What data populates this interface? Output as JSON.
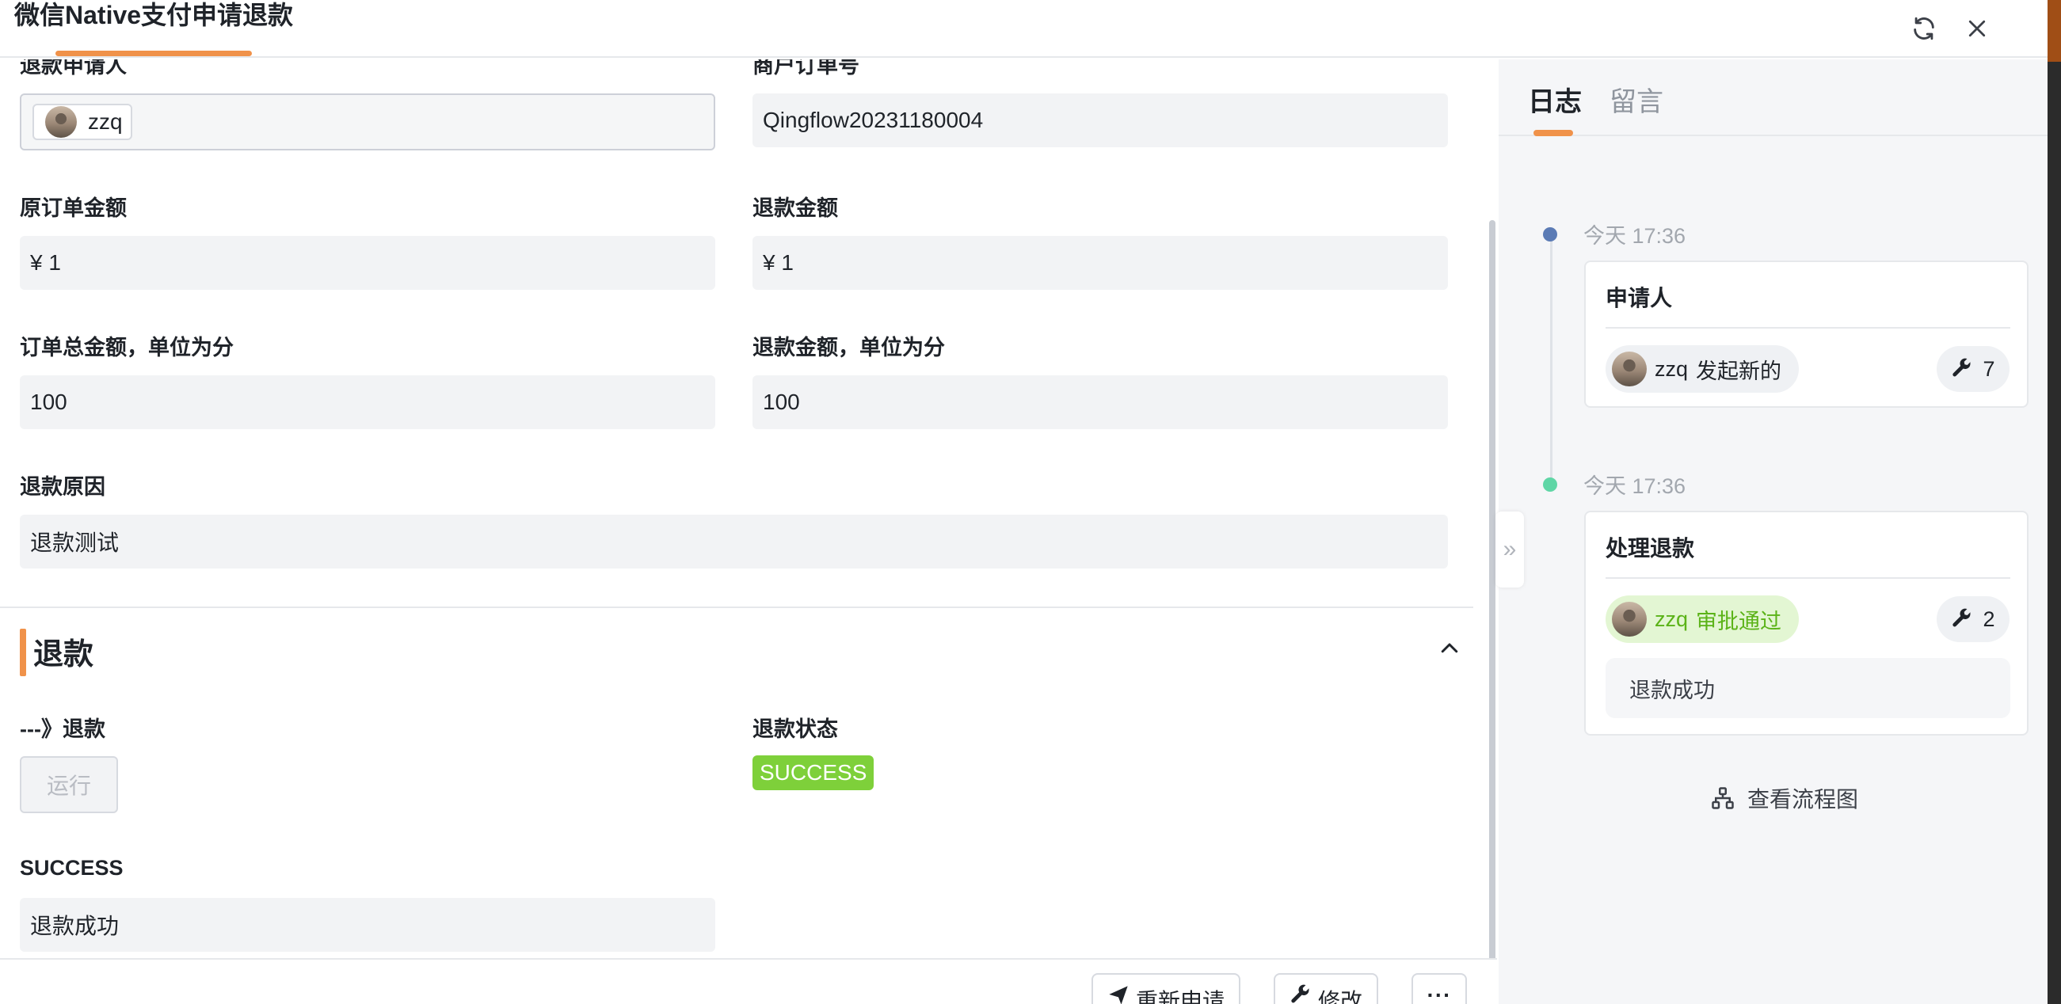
{
  "header": {
    "title": "微信Native支付申请退款",
    "refresh_icon": "refresh-icon",
    "close_icon": "close-icon"
  },
  "form": {
    "applicant_label": "退款申请人",
    "applicant_name": "zzq",
    "merchant_order_label": "商户订单号",
    "merchant_order_value": "Qingflow20231180004",
    "original_amount_label": "原订单金额",
    "original_amount_value": "¥ 1",
    "refund_amount_label": "退款金额",
    "refund_amount_value": "¥ 1",
    "total_cents_label": "订单总金额，单位为分",
    "total_cents_value": "100",
    "refund_cents_label": "退款金额，单位为分",
    "refund_cents_value": "100",
    "reason_label": "退款原因",
    "reason_value": "退款测试"
  },
  "refund_section": {
    "title": "退款",
    "action_label": "---》退款",
    "run_button": "运行",
    "status_label": "退款状态",
    "status_value": "SUCCESS",
    "success_label": "SUCCESS",
    "success_value": "退款成功"
  },
  "footer": {
    "reapply_label": "重新申请",
    "edit_label": "修改",
    "more_label": "···"
  },
  "side": {
    "tabs": [
      {
        "label": "日志",
        "active": true
      },
      {
        "label": "留言",
        "active": false
      }
    ],
    "timeline": [
      {
        "time": "今天 17:36",
        "dot_color": "#5b7bb5",
        "node": "申请人",
        "actor": "zzq",
        "action": "发起新的",
        "count": "7",
        "comment": ""
      },
      {
        "time": "今天 17:36",
        "dot_color": "#5fd6a6",
        "node": "处理退款",
        "actor": "zzq",
        "action": "审批通过",
        "count": "2",
        "comment": "退款成功"
      }
    ],
    "flow_link": "查看流程图"
  },
  "colors": {
    "accent": "#f0924a",
    "success": "#7ed03a",
    "approved_text": "#5bb318"
  }
}
